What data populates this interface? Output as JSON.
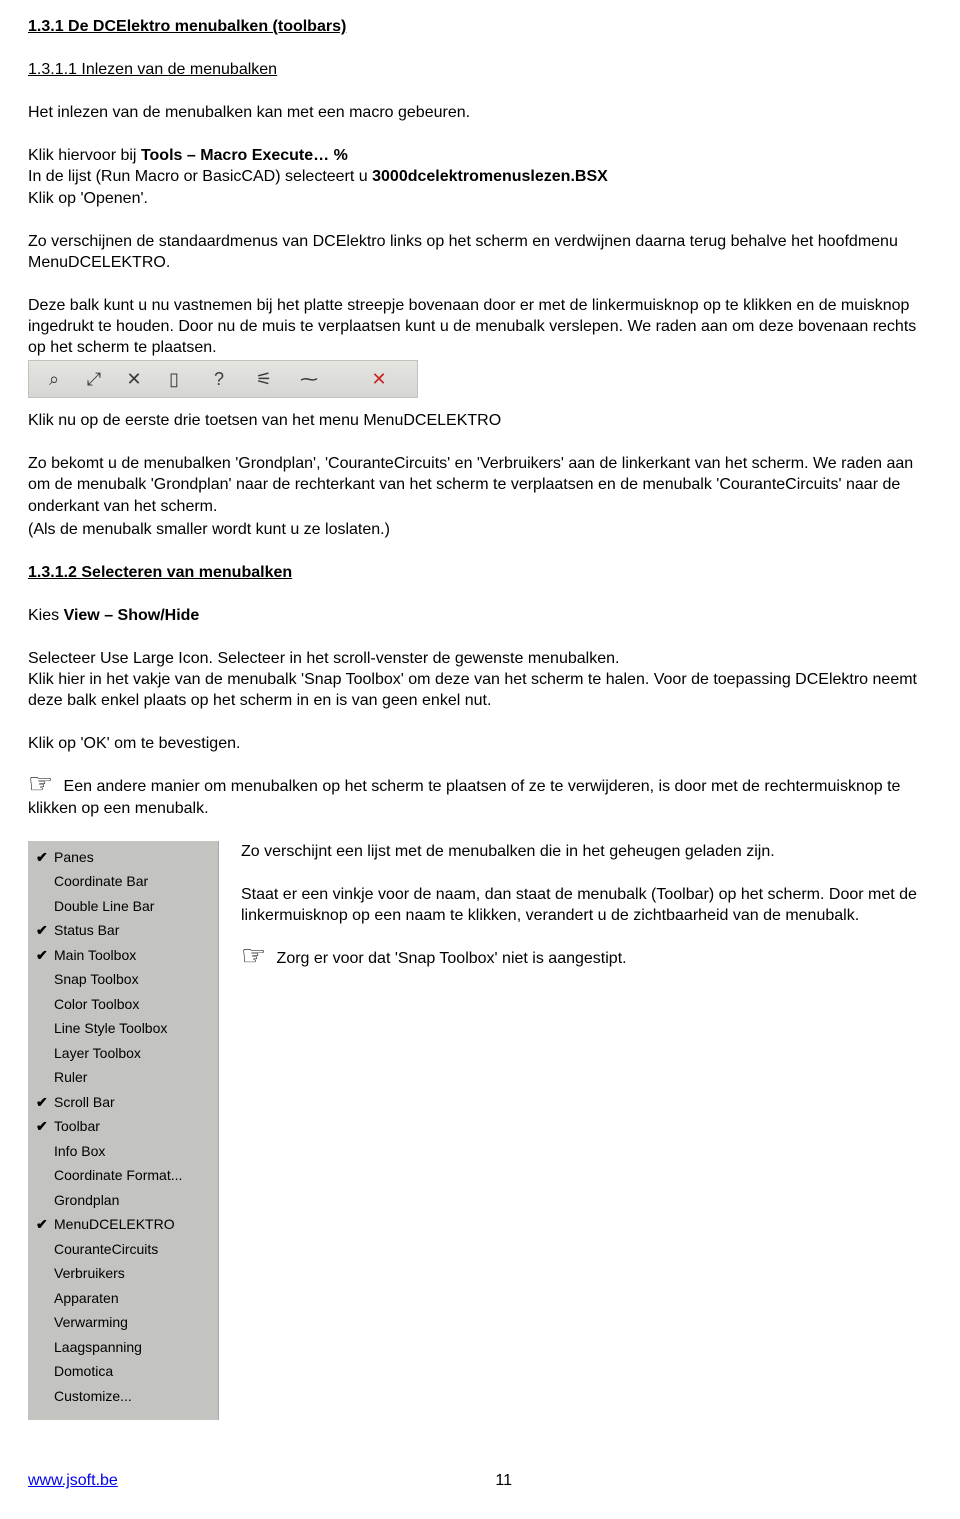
{
  "headings": {
    "h131": "1.3.1  De DCElektro menubalken (toolbars)",
    "h1311": "1.3.1.1  Inlezen van de menubalken",
    "h1312": "1.3.1.2  Selecteren van menubalken"
  },
  "intro1": "Het inlezen van de menubalken kan met een macro gebeuren.",
  "intro2a": "Klik hiervoor bij ",
  "intro2_bold": "Tools – Macro Execute…   %",
  "intro2b": "In de lijst (Run Macro or BasicCAD) selecteert u ",
  "intro2_bold2": "3000dcelektromenuslezen.BSX",
  "intro2c": "Klik op 'Openen'.",
  "intro3": "Zo verschijnen de standaardmenus van DCElektro links op het scherm en verdwijnen daarna terug behalve het hoofdmenu MenuDCELEKTRO.",
  "intro4": "Deze balk kunt u nu vastnemen bij het platte streepje bovenaan door er met de linkermuisknop op te klikken en de muisknop ingedrukt te houden. Door nu de muis te verplaatsen kunt u de menubalk verslepen. We raden aan om deze bovenaan rechts op het scherm te plaatsen.",
  "after_toolbar_1": "Klik nu op de eerste drie toetsen van het menu MenuDCELEKTRO",
  "after_toolbar_2": "Zo bekomt u de menubalken 'Grondplan', 'CouranteCircuits' en 'Verbruikers' aan de linkerkant van het scherm. We raden aan om de menubalk 'Grondplan' naar de rechterkant van het scherm te verplaatsen en de menubalk 'CouranteCircuits' naar de onderkant van het scherm.",
  "after_toolbar_3": "(Als de menubalk smaller wordt kunt u ze loslaten.)",
  "kies_a": "Kies ",
  "kies_b": "View – Show/Hide",
  "select_paragraph": "Selecteer Use Large Icon. Selecteer in het scroll-venster de gewenste menubalken.\nKlik hier in het vakje van de menubalk 'Snap Toolbox' om deze van het scherm te halen. Voor de toepassing DCElektro neemt deze balk enkel plaats op het scherm in en is van geen enkel nut.",
  "click_ok": "Klik op 'OK' om te bevestigen.",
  "hand_note_1": " Een andere manier om menubalken op het scherm te plaatsen of ze te verwijderen, is door met de rechtermuisknop te klikken op een menubalk.",
  "right_text_1": "Zo verschijnt een lijst met de menubalken die in het geheugen geladen zijn.",
  "right_text_2": "Staat er een vinkje voor de naam, dan staat de menubalk (Toolbar) op het scherm. Door met de linkermuisknop op een naam te klikken, verandert u de zichtbaarheid van de menubalk.",
  "hand_note_2": " Zorg er voor dat 'Snap Toolbox' niet is aangestipt.",
  "menu_items": [
    {
      "label": "Panes",
      "checked": true
    },
    {
      "label": "Coordinate Bar",
      "checked": false
    },
    {
      "label": "Double Line Bar",
      "checked": false
    },
    {
      "label": "Status Bar",
      "checked": true
    },
    {
      "label": "Main Toolbox",
      "checked": true
    },
    {
      "label": "Snap Toolbox",
      "checked": false
    },
    {
      "label": "Color Toolbox",
      "checked": false
    },
    {
      "label": "Line Style Toolbox",
      "checked": false
    },
    {
      "label": "Layer Toolbox",
      "checked": false
    },
    {
      "label": "Ruler",
      "checked": false
    },
    {
      "label": "Scroll Bar",
      "checked": true
    },
    {
      "label": "Toolbar",
      "checked": true
    },
    {
      "label": "Info Box",
      "checked": false
    },
    {
      "label": "Coordinate Format...",
      "checked": false
    },
    {
      "label": "Grondplan",
      "checked": false
    },
    {
      "label": "MenuDCELEKTRO",
      "checked": true
    },
    {
      "label": "CouranteCircuits",
      "checked": false
    },
    {
      "label": "Verbruikers",
      "checked": false
    },
    {
      "label": "Apparaten",
      "checked": false
    },
    {
      "label": "Verwarming",
      "checked": false
    },
    {
      "label": "Laagspanning",
      "checked": false
    },
    {
      "label": "Domotica",
      "checked": false
    },
    {
      "label": "Customize...",
      "checked": false
    }
  ],
  "toolbar_icons": [
    {
      "name": "icon-1",
      "glyph": "⌕"
    },
    {
      "name": "icon-2",
      "glyph": "⤢"
    },
    {
      "name": "icon-3",
      "glyph": "✕"
    },
    {
      "name": "icon-4",
      "glyph": "▯"
    },
    {
      "name": "icon-5",
      "glyph": "?"
    },
    {
      "name": "icon-6",
      "glyph": "⚟"
    },
    {
      "name": "icon-7",
      "glyph": "⁓"
    },
    {
      "name": "icon-8",
      "glyph": "✕"
    }
  ],
  "footer": {
    "url": "www.jsoft.be",
    "page": "11"
  }
}
